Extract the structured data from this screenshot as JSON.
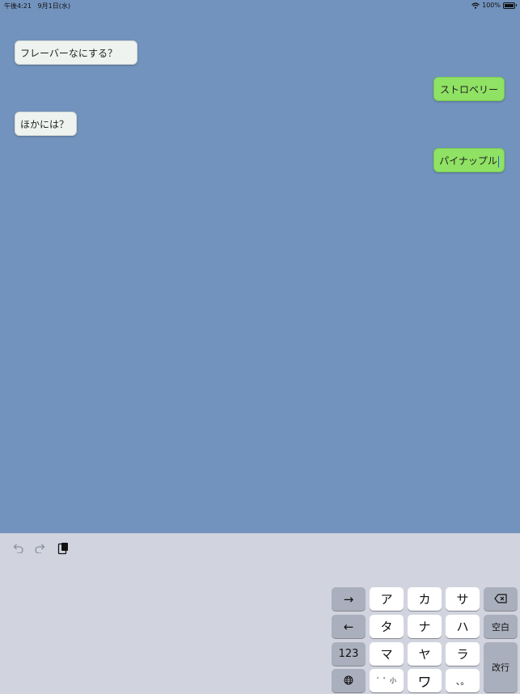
{
  "status": {
    "time": "午後4:21",
    "date": "9月1日(水)",
    "battery": "100%",
    "wifi_icon": "wifi-icon",
    "battery_level": 1.0
  },
  "messages": [
    {
      "side": "in",
      "text": "フレーバーなにする？"
    },
    {
      "side": "out",
      "text": "ストロベリー"
    },
    {
      "side": "in",
      "text": "ほかには？"
    },
    {
      "side": "out",
      "text": "パイナップル"
    }
  ],
  "toolbar": {
    "undo_icon": "undo-icon",
    "redo_icon": "redo-icon",
    "paste_icon": "clipboard-icon"
  },
  "keyboard": {
    "arrow_right": "→",
    "arrow_left": "←",
    "numbers": "123",
    "globe_icon": "globe-icon",
    "kana": [
      "ア",
      "カ",
      "サ",
      "タ",
      "ナ",
      "ハ",
      "マ",
      "ヤ",
      "ラ",
      "ワ"
    ],
    "dakuten": "゛゜小",
    "punct": "、。",
    "delete_icon": "delete-icon",
    "space": "空白",
    "enter": "改行"
  },
  "colors": {
    "background": "#7293be",
    "incoming_bubble": "#eff3f0",
    "outgoing_bubble": "#8fe263",
    "keyboard_bg": "#d1d4de"
  }
}
